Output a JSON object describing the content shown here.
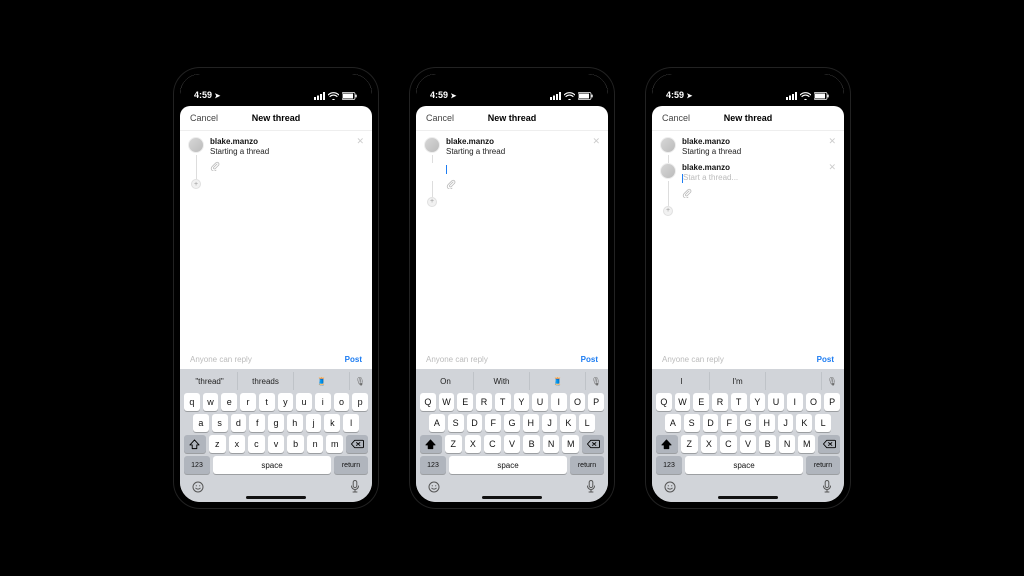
{
  "status": {
    "time": "4:59",
    "loc_arrow": "↗"
  },
  "nav": {
    "cancel": "Cancel",
    "title": "New thread"
  },
  "user": "blake.manzo",
  "footer": {
    "anyone": "Anyone can reply",
    "post": "Post"
  },
  "screens": [
    {
      "posts": [
        {
          "user": "blake.manzo",
          "text": "Starting a thread",
          "cursor": false,
          "attach": true,
          "close": true
        }
      ],
      "show_second_entry": false,
      "suggestions": [
        "\"thread\"",
        "threads"
      ],
      "sugg_emoji": "🧵",
      "keys_upper": false
    },
    {
      "posts": [
        {
          "user": "blake.manzo",
          "text": "Starting a thread",
          "cursor": false,
          "attach": false,
          "close": true
        },
        {
          "user": "",
          "text": "",
          "cursor": true,
          "attach": true,
          "close": false
        }
      ],
      "show_second_entry": false,
      "suggestions": [
        "On",
        "With"
      ],
      "sugg_emoji": "🧵",
      "keys_upper": true
    },
    {
      "posts": [
        {
          "user": "blake.manzo",
          "text": "Starting a thread",
          "cursor": false,
          "attach": false,
          "close": true
        }
      ],
      "second": {
        "user": "blake.manzo",
        "placeholder": "Start a thread...",
        "close": true
      },
      "show_second_entry": true,
      "suggestions": [
        "I",
        "I'm"
      ],
      "sugg_emoji": "",
      "keys_upper": true
    }
  ],
  "kb": {
    "row1_lower": [
      "q",
      "w",
      "e",
      "r",
      "t",
      "y",
      "u",
      "i",
      "o",
      "p"
    ],
    "row1_upper": [
      "Q",
      "W",
      "E",
      "R",
      "T",
      "Y",
      "U",
      "I",
      "O",
      "P"
    ],
    "row2_lower": [
      "a",
      "s",
      "d",
      "f",
      "g",
      "h",
      "j",
      "k",
      "l"
    ],
    "row2_upper": [
      "A",
      "S",
      "D",
      "F",
      "G",
      "H",
      "J",
      "K",
      "L"
    ],
    "row3_lower": [
      "z",
      "x",
      "c",
      "v",
      "b",
      "n",
      "m"
    ],
    "row3_upper": [
      "Z",
      "X",
      "C",
      "V",
      "B",
      "N",
      "M"
    ],
    "num": "123",
    "space": "space",
    "ret": "return"
  }
}
